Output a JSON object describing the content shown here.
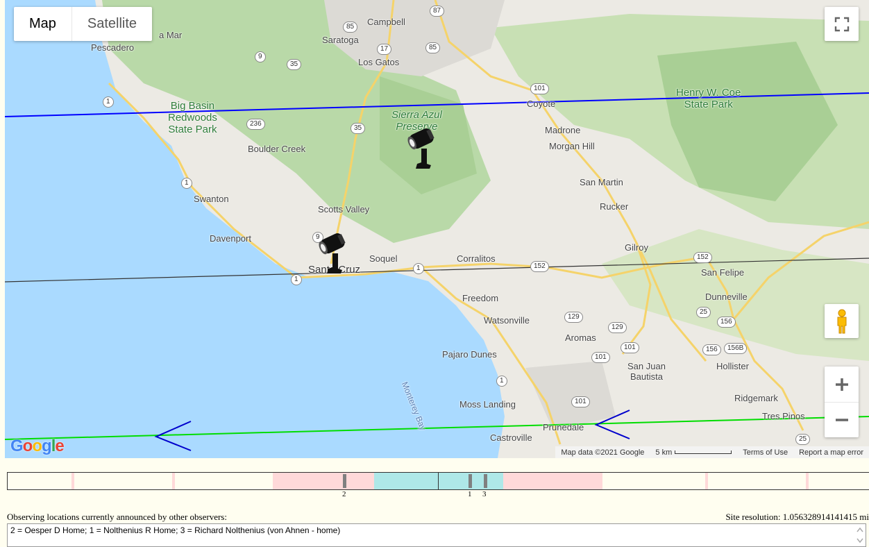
{
  "map": {
    "type_control": {
      "map_label": "Map",
      "satellite_label": "Satellite"
    },
    "places": {
      "campbell": "Campbell",
      "saratoga": "Saratoga",
      "los_gatos": "Los Gatos",
      "pescadero": "Pescadero",
      "la_mar": "a Mar",
      "big_basin": "Big Basin\nRedwoods\nState Park",
      "sierra_azul": "Sierra Azul\nPreserve",
      "henry_coe": "Henry W. Coe\nState Park",
      "coyote": "Coyote",
      "madrone": "Madrone",
      "morgan_hill": "Morgan Hill",
      "boulder_creek": "Boulder Creek",
      "san_martin": "San Martin",
      "rucker": "Rucker",
      "swanton": "Swanton",
      "scotts_valley": "Scotts Valley",
      "davenport": "Davenport",
      "gilroy": "Gilroy",
      "santa_cruz": "Santa Cruz",
      "soquel": "Soquel",
      "corralitos": "Corralitos",
      "san_felipe": "San Felipe",
      "freedom": "Freedom",
      "dunneville": "Dunneville",
      "watsonville": "Watsonville",
      "aromas": "Aromas",
      "pajaro_dunes": "Pajaro Dunes",
      "san_juan_bautista": "San Juan\nBautista",
      "hollister": "Hollister",
      "moss_landing": "Moss Landing",
      "ridgemark": "Ridgemark",
      "prunedale": "Prunedale",
      "tres_pinos": "Tres Pinos",
      "castroville": "Castroville",
      "monterey_bay": "Monterey Bay"
    },
    "shields": {
      "s87": "87",
      "s85a": "85",
      "s85b": "85",
      "s17": "17",
      "s9a": "9",
      "s35a": "35",
      "s101a": "101",
      "s1a": "1",
      "s236": "236",
      "s35b": "35",
      "s1b": "1",
      "s9b": "9",
      "s1c": "1",
      "s1d": "1",
      "s152a": "152",
      "s152b": "152",
      "s129a": "129",
      "s129b": "129",
      "s25a": "25",
      "s156a": "156",
      "s156b": "156",
      "s156c": "156B",
      "s101b": "101",
      "s101c": "101",
      "s1e": "1",
      "s101d": "101",
      "s25b": "25"
    },
    "google_logo": "Google",
    "attribution": {
      "map_data": "Map data ©2021 Google",
      "scale": "5 km",
      "terms": "Terms of Use",
      "report": "Report a map error"
    },
    "line_colors": {
      "north_limit": "#0000ff",
      "center_line": "#333333",
      "south_limit": "#00dd00",
      "direction_arrow": "#0000cc"
    }
  },
  "timeline": {
    "labels": {
      "two": "2",
      "one": "1",
      "three": "3"
    },
    "colors": {
      "base": "#fffef0",
      "pink": "#ffd9d9",
      "cyan": "#aee8e8",
      "marker": "#808080"
    }
  },
  "observers": {
    "label": "Observing locations currently announced by other observers:",
    "site_resolution": "Site resolution: 1.056328914141415 mi",
    "list": "2 = Oesper D Home; 1 = Nolthenius R Home; 3 = Richard Nolthenius (von Ahnen - home)"
  }
}
